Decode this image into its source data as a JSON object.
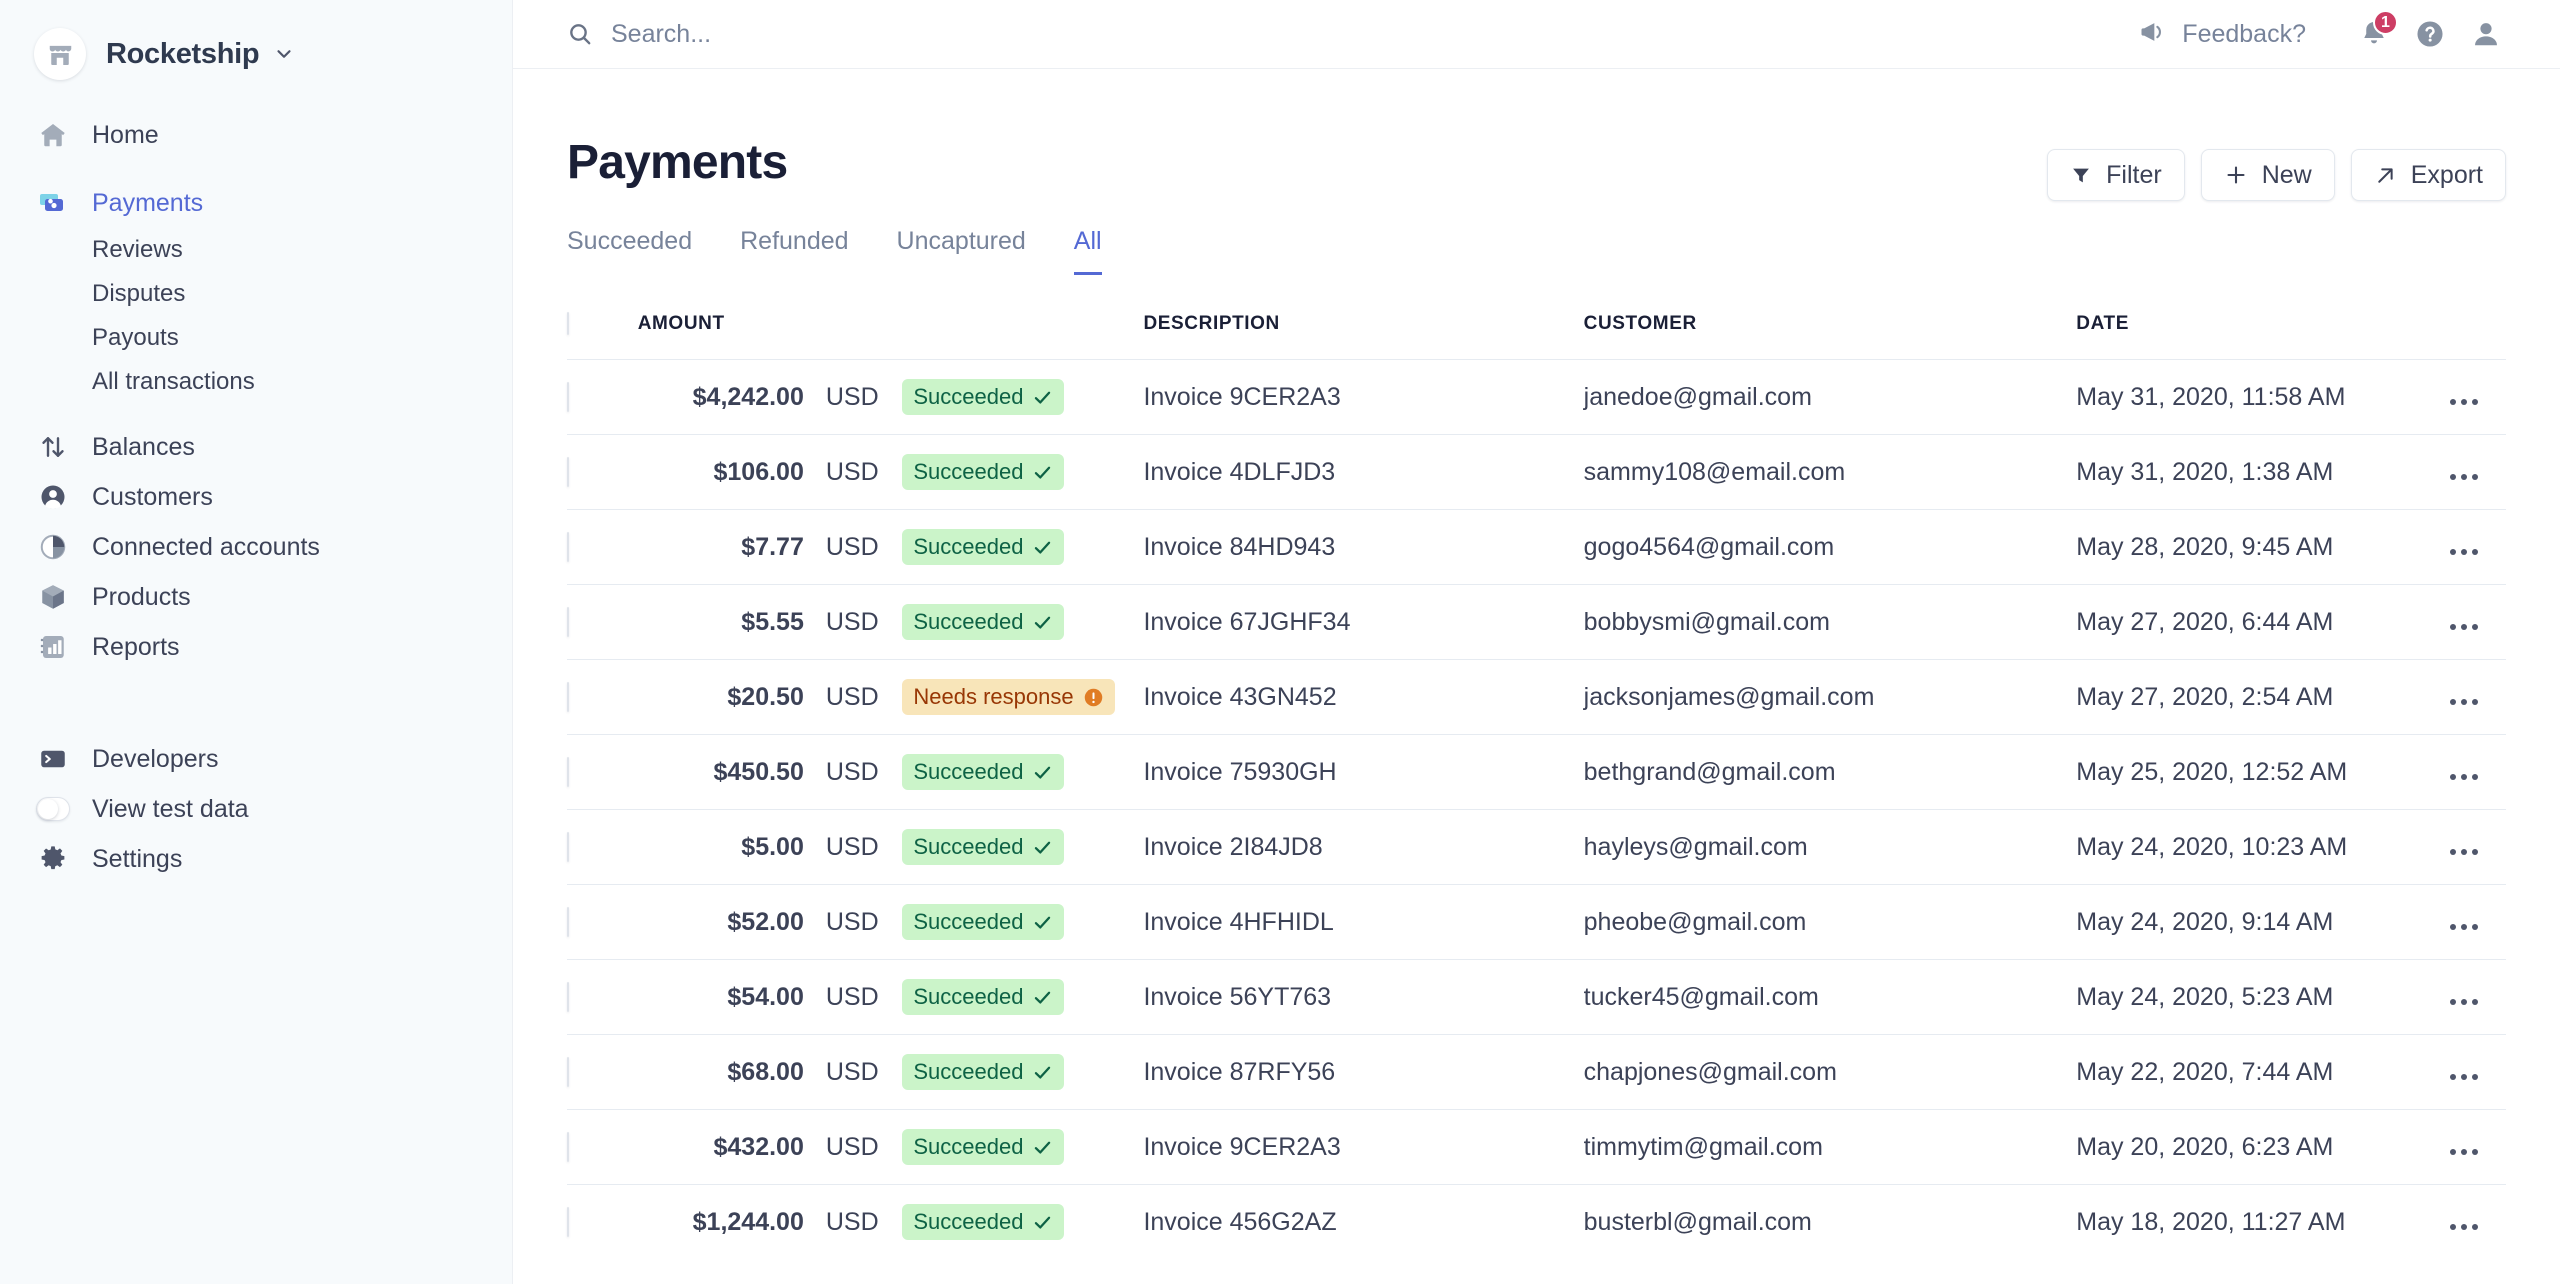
{
  "colors": {
    "accent": "#5469d4",
    "sidebar_bg": "#f7fafc",
    "title": "#1a1f36",
    "muted": "#77839a",
    "badge_success_bg": "#cbf4c9",
    "badge_success_text": "#0e6245",
    "badge_warn_bg": "#f8e5b9",
    "badge_warn_text": "#983705",
    "notification_badge": "#cd3d64"
  },
  "sidebar": {
    "brand": {
      "name": "Rocketship",
      "avatar_icon": "storefront-icon",
      "caret_icon": "chevron-down-icon"
    },
    "items": [
      {
        "label": "Home",
        "icon": "home-icon",
        "active": false
      },
      {
        "label": "Payments",
        "icon": "payments-cards-icon",
        "active": true
      }
    ],
    "sub_items": [
      {
        "label": "Reviews"
      },
      {
        "label": "Disputes"
      },
      {
        "label": "Payouts"
      },
      {
        "label": "All transactions"
      }
    ],
    "items2": [
      {
        "label": "Balances",
        "icon": "arrows-up-down-icon"
      },
      {
        "label": "Customers",
        "icon": "person-circle-icon"
      },
      {
        "label": "Connected accounts",
        "icon": "pie-chart-icon"
      },
      {
        "label": "Products",
        "icon": "box-icon"
      },
      {
        "label": "Reports",
        "icon": "bar-chart-icon"
      }
    ],
    "items3": [
      {
        "label": "Developers",
        "icon": "terminal-icon"
      }
    ],
    "test_data": {
      "label": "View test data",
      "icon": "toggle-switch-icon",
      "enabled": false
    },
    "settings": {
      "label": "Settings",
      "icon": "gear-icon"
    }
  },
  "topbar": {
    "search": {
      "placeholder": "Search...",
      "value": "",
      "icon": "search-icon"
    },
    "feedback": {
      "label": "Feedback?",
      "icon": "megaphone-icon"
    },
    "notifications": {
      "icon": "bell-icon",
      "count": "1"
    },
    "help": {
      "icon": "question-circle-icon"
    },
    "account": {
      "icon": "user-avatar-icon"
    }
  },
  "page": {
    "title": "Payments",
    "actions": [
      {
        "label": "Filter",
        "icon": "funnel-icon"
      },
      {
        "label": "New",
        "icon": "plus-icon"
      },
      {
        "label": "Export",
        "icon": "arrow-up-right-icon"
      }
    ],
    "tabs": [
      {
        "label": "Succeeded",
        "active": false
      },
      {
        "label": "Refunded",
        "active": false
      },
      {
        "label": "Uncaptured",
        "active": false
      },
      {
        "label": "All",
        "active": true
      }
    ]
  },
  "table": {
    "columns": [
      "AMOUNT",
      "DESCRIPTION",
      "CUSTOMER",
      "DATE"
    ],
    "select_all_checked": false,
    "rows": [
      {
        "amount": "$4,242.00",
        "currency": "USD",
        "status": "Succeeded",
        "status_type": "succeeded",
        "description": "Invoice 9CER2A3",
        "customer": "janedoe@gmail.com",
        "date": "May 31, 2020, 11:58 AM"
      },
      {
        "amount": "$106.00",
        "currency": "USD",
        "status": "Succeeded",
        "status_type": "succeeded",
        "description": "Invoice 4DLFJD3",
        "customer": "sammy108@email.com",
        "date": "May 31, 2020, 1:38 AM"
      },
      {
        "amount": "$7.77",
        "currency": "USD",
        "status": "Succeeded",
        "status_type": "succeeded",
        "description": "Invoice 84HD943",
        "customer": "gogo4564@gmail.com",
        "date": "May 28, 2020, 9:45 AM"
      },
      {
        "amount": "$5.55",
        "currency": "USD",
        "status": "Succeeded",
        "status_type": "succeeded",
        "description": "Invoice 67JGHF34",
        "customer": "bobbysmi@gmail.com",
        "date": "May 27, 2020, 6:44 AM"
      },
      {
        "amount": "$20.50",
        "currency": "USD",
        "status": "Needs response",
        "status_type": "needs",
        "description": "Invoice 43GN452",
        "customer": "jacksonjames@gmail.com",
        "date": "May 27, 2020, 2:54 AM"
      },
      {
        "amount": "$450.50",
        "currency": "USD",
        "status": "Succeeded",
        "status_type": "succeeded",
        "description": "Invoice 75930GH",
        "customer": "bethgrand@gmail.com",
        "date": "May 25, 2020, 12:52 AM"
      },
      {
        "amount": "$5.00",
        "currency": "USD",
        "status": "Succeeded",
        "status_type": "succeeded",
        "description": "Invoice 2I84JD8",
        "customer": "hayleys@gmail.com",
        "date": "May 24, 2020, 10:23 AM"
      },
      {
        "amount": "$52.00",
        "currency": "USD",
        "status": "Succeeded",
        "status_type": "succeeded",
        "description": "Invoice 4HFHIDL",
        "customer": "pheobe@gmail.com",
        "date": "May 24, 2020, 9:14 AM"
      },
      {
        "amount": "$54.00",
        "currency": "USD",
        "status": "Succeeded",
        "status_type": "succeeded",
        "description": "Invoice 56YT763",
        "customer": "tucker45@gmail.com",
        "date": "May 24, 2020, 5:23 AM"
      },
      {
        "amount": "$68.00",
        "currency": "USD",
        "status": "Succeeded",
        "status_type": "succeeded",
        "description": "Invoice 87RFY56",
        "customer": "chapjones@gmail.com",
        "date": "May 22, 2020, 7:44 AM"
      },
      {
        "amount": "$432.00",
        "currency": "USD",
        "status": "Succeeded",
        "status_type": "succeeded",
        "description": "Invoice 9CER2A3",
        "customer": "timmytim@gmail.com",
        "date": "May 20, 2020, 6:23 AM"
      },
      {
        "amount": "$1,244.00",
        "currency": "USD",
        "status": "Succeeded",
        "status_type": "succeeded",
        "description": "Invoice 456G2AZ",
        "customer": "busterbl@gmail.com",
        "date": "May 18, 2020, 11:27 AM"
      }
    ]
  }
}
